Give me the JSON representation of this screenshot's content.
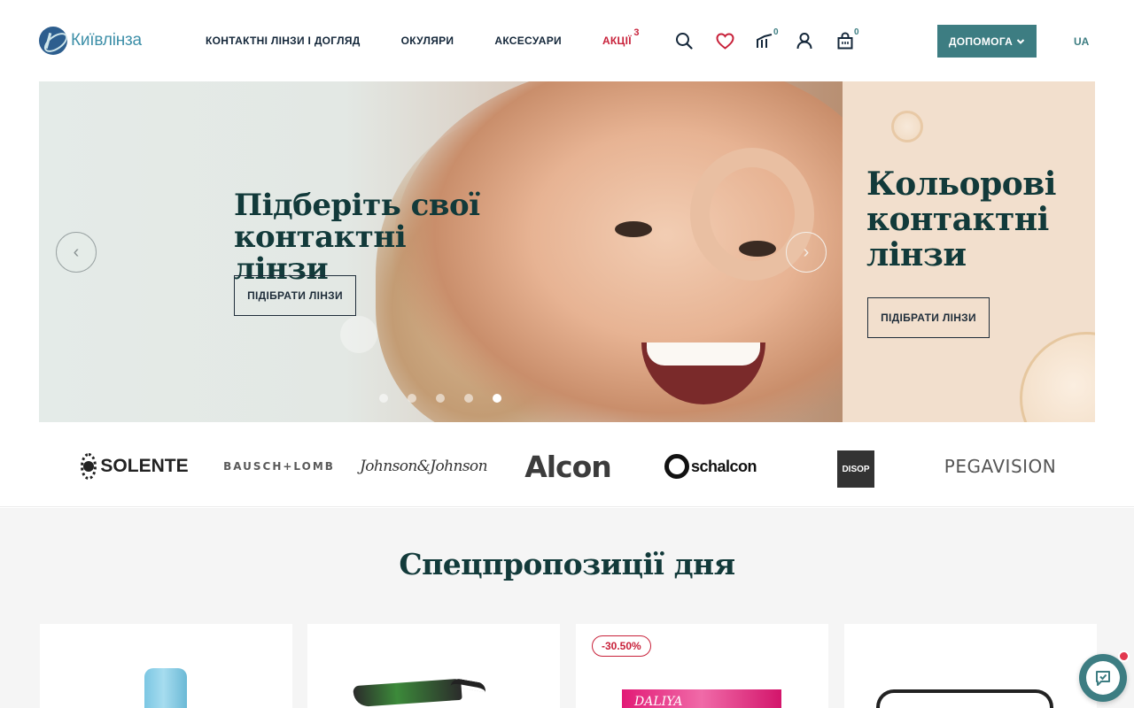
{
  "header": {
    "logo_text": "Київлінза",
    "nav": [
      "КОНТАКТНІ ЛІНЗИ І ДОГЛЯД",
      "ОКУЛЯРИ",
      "АКСЕСУАРИ",
      "АКЦІЇ"
    ],
    "promo_count": "3",
    "compare_count": "0",
    "cart_count": "0",
    "help_label": "ДОПОМОГА",
    "lang": "UA",
    "icons": [
      "search-icon",
      "heart-icon",
      "compare-icon",
      "user-icon",
      "cart-icon",
      "chevron-down-icon"
    ],
    "accent_color": "#3d7d82",
    "promo_color": "#c8213a"
  },
  "hero": {
    "title": "Підберіть свої контактні лінзи",
    "button": "ПІДІБРАТИ ЛІНЗИ",
    "prev_symbol": "‹",
    "next_symbol": "›",
    "slide_count": 5,
    "active_slide": 5
  },
  "side_banner": {
    "title": "Кольорові контактні лінзи",
    "button": "ПІДІБРАТИ ЛІНЗИ"
  },
  "brands": [
    "SOLENTE",
    "BAUSCH+LOMB",
    "Johnson&Johnson",
    "Alcon",
    "schalcon",
    "DISOP",
    "PEGAVISION"
  ],
  "offers": {
    "title": "Спецпропозиції дня",
    "products": [
      {
        "badge": ""
      },
      {
        "badge": ""
      },
      {
        "badge": "-30.50%",
        "box_label": "DALIYA"
      },
      {
        "badge": ""
      }
    ]
  }
}
